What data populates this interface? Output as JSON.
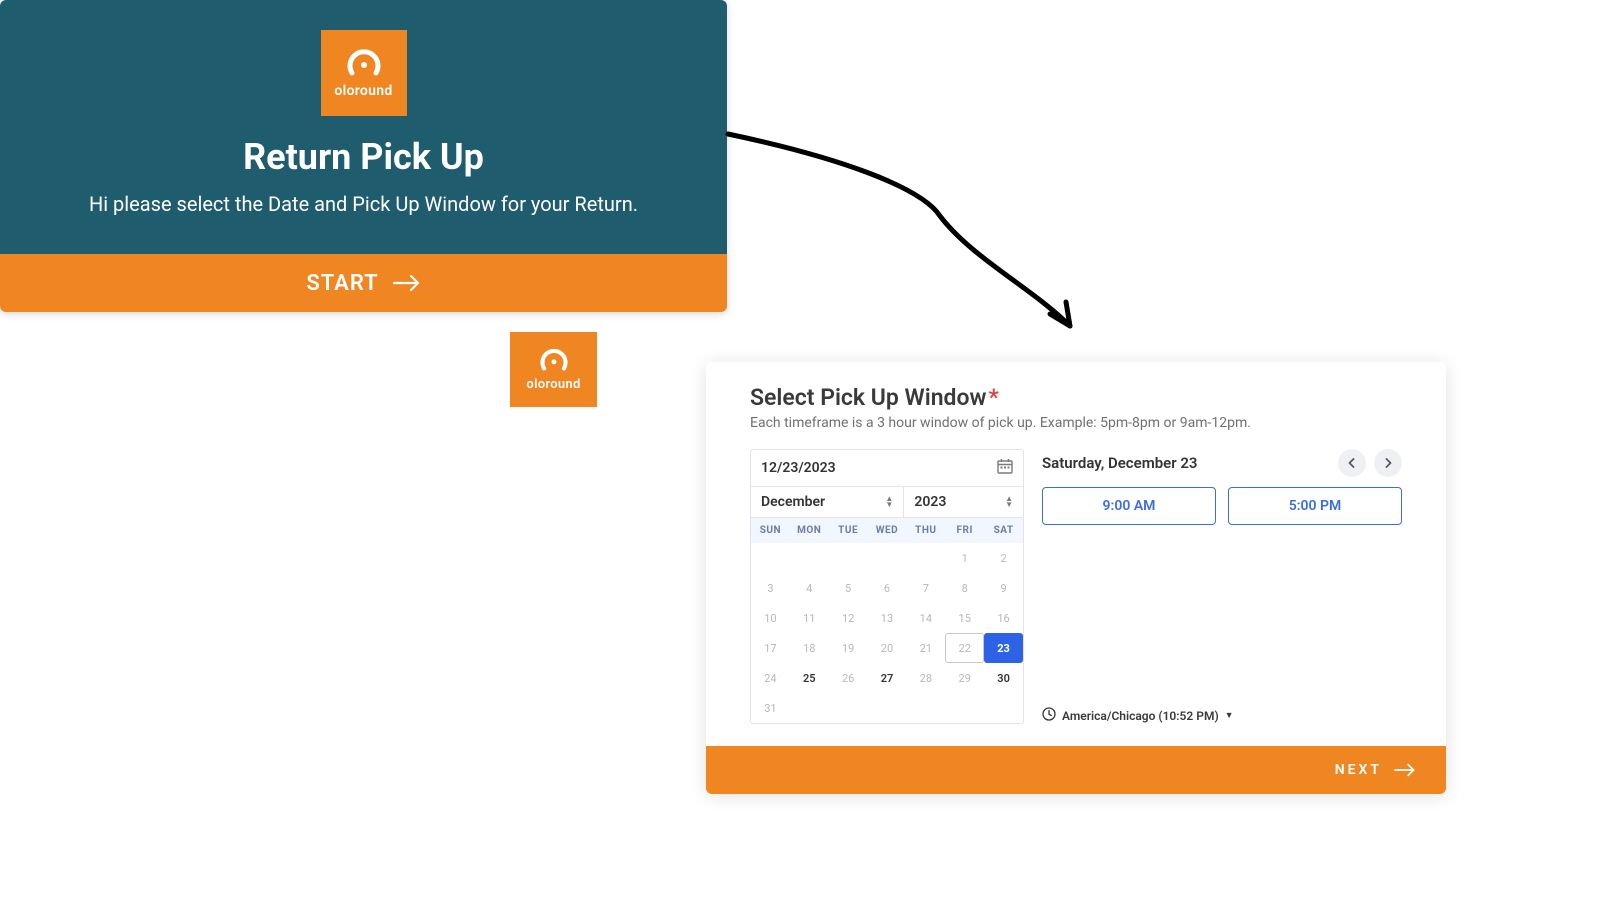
{
  "brand": {
    "name": "oloround"
  },
  "panel1": {
    "title": "Return Pick Up",
    "subtitle": "Hi please select the Date and Pick Up Window for your Return.",
    "start_label": "START"
  },
  "panel2": {
    "title": "Select Pick Up Window",
    "required_mark": "*",
    "subtitle": "Each timeframe is a 3 hour window of pick up. Example: 5pm-8pm or 9am-12pm.",
    "date_input": "12/23/2023",
    "month_label": "December",
    "year_label": "2023",
    "dow": [
      "SUN",
      "MON",
      "TUE",
      "WED",
      "THU",
      "FRI",
      "SAT"
    ],
    "weeks": [
      [
        {
          "d": ""
        },
        {
          "d": ""
        },
        {
          "d": ""
        },
        {
          "d": ""
        },
        {
          "d": ""
        },
        {
          "d": "1"
        },
        {
          "d": "2"
        }
      ],
      [
        {
          "d": "3"
        },
        {
          "d": "4"
        },
        {
          "d": "5"
        },
        {
          "d": "6"
        },
        {
          "d": "7"
        },
        {
          "d": "8"
        },
        {
          "d": "9"
        }
      ],
      [
        {
          "d": "10"
        },
        {
          "d": "11"
        },
        {
          "d": "12"
        },
        {
          "d": "13"
        },
        {
          "d": "14"
        },
        {
          "d": "15"
        },
        {
          "d": "16"
        }
      ],
      [
        {
          "d": "17"
        },
        {
          "d": "18"
        },
        {
          "d": "19"
        },
        {
          "d": "20"
        },
        {
          "d": "21"
        },
        {
          "d": "22",
          "today": true
        },
        {
          "d": "23",
          "selected": true
        }
      ],
      [
        {
          "d": "24"
        },
        {
          "d": "25",
          "avail": true
        },
        {
          "d": "26"
        },
        {
          "d": "27",
          "avail": true
        },
        {
          "d": "28"
        },
        {
          "d": "29"
        },
        {
          "d": "30",
          "avail": true
        }
      ],
      [
        {
          "d": "31"
        },
        {
          "d": ""
        },
        {
          "d": ""
        },
        {
          "d": ""
        },
        {
          "d": ""
        },
        {
          "d": ""
        },
        {
          "d": ""
        }
      ]
    ],
    "slots_date": "Saturday, December 23",
    "slots": [
      "9:00 AM",
      "5:00 PM"
    ],
    "timezone": "America/Chicago (10:52 PM)",
    "next_label": "NEXT"
  }
}
